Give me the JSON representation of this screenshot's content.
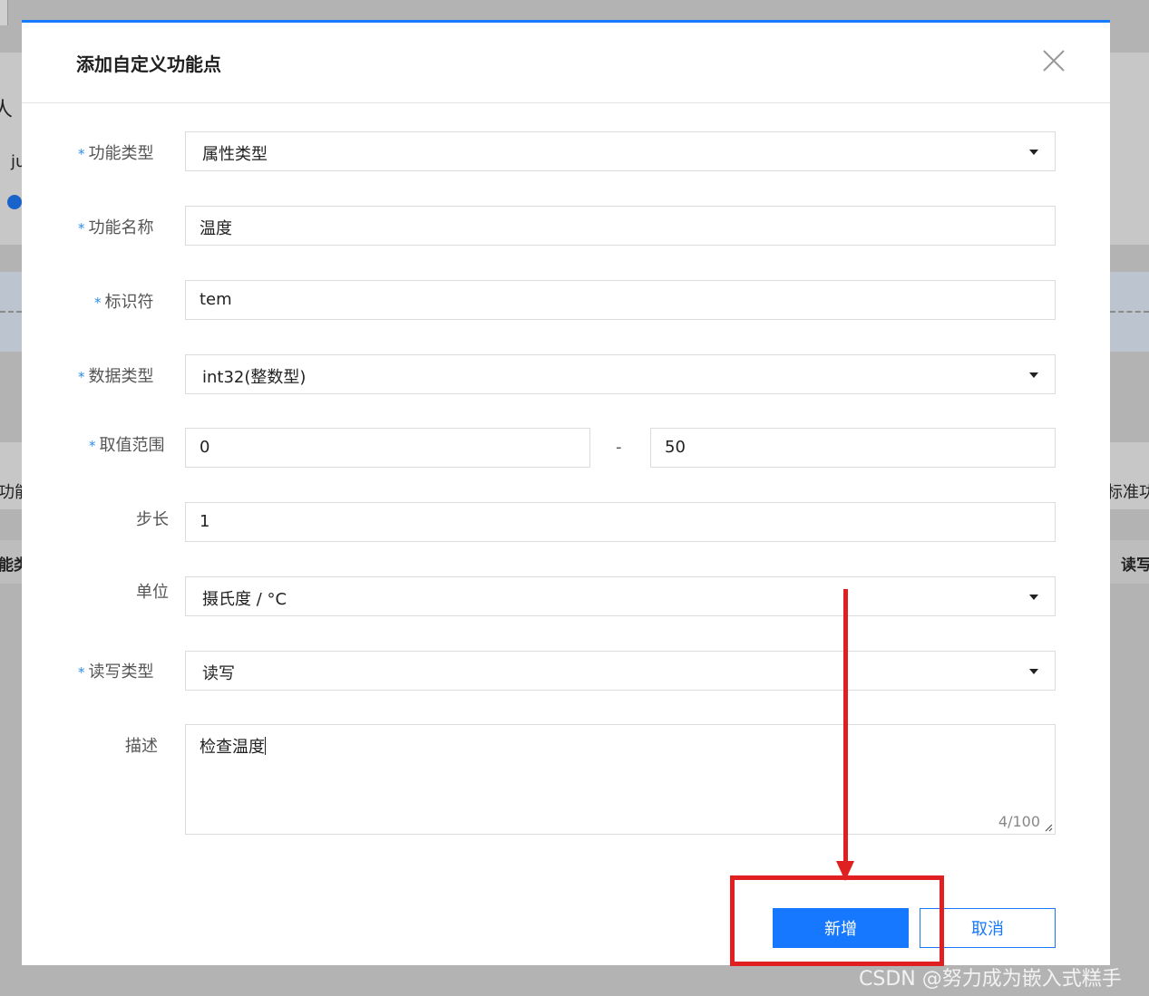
{
  "background": {
    "fragments": [
      "人",
      "ju",
      "功能",
      "标准功",
      "能类",
      "读写"
    ]
  },
  "dialog": {
    "title": "添加自定义功能点",
    "close_icon": "close-icon",
    "required_mark": "*",
    "fields": {
      "func_type": {
        "label": "功能类型",
        "value": "属性类型"
      },
      "func_name": {
        "label": "功能名称",
        "value": "温度"
      },
      "identifier": {
        "label": "标识符",
        "value": "tem"
      },
      "data_type": {
        "label": "数据类型",
        "value": "int32(整数型)"
      },
      "range": {
        "label": "取值范围",
        "min": "0",
        "separator": "-",
        "max": "50"
      },
      "step": {
        "label": "步长",
        "value": "1"
      },
      "unit": {
        "label": "单位",
        "value": "摄氏度 / °C"
      },
      "rw_type": {
        "label": "读写类型",
        "value": "读写"
      },
      "description": {
        "label": "描述",
        "value": "检查温度",
        "counter": "4/100"
      }
    },
    "buttons": {
      "submit": "新增",
      "cancel": "取消"
    }
  },
  "annotation": {
    "color": "#e02020"
  },
  "watermark": "CSDN @努力成为嵌入式糕手",
  "colors": {
    "accent": "#1677ff",
    "required": "#2d8cf0"
  }
}
